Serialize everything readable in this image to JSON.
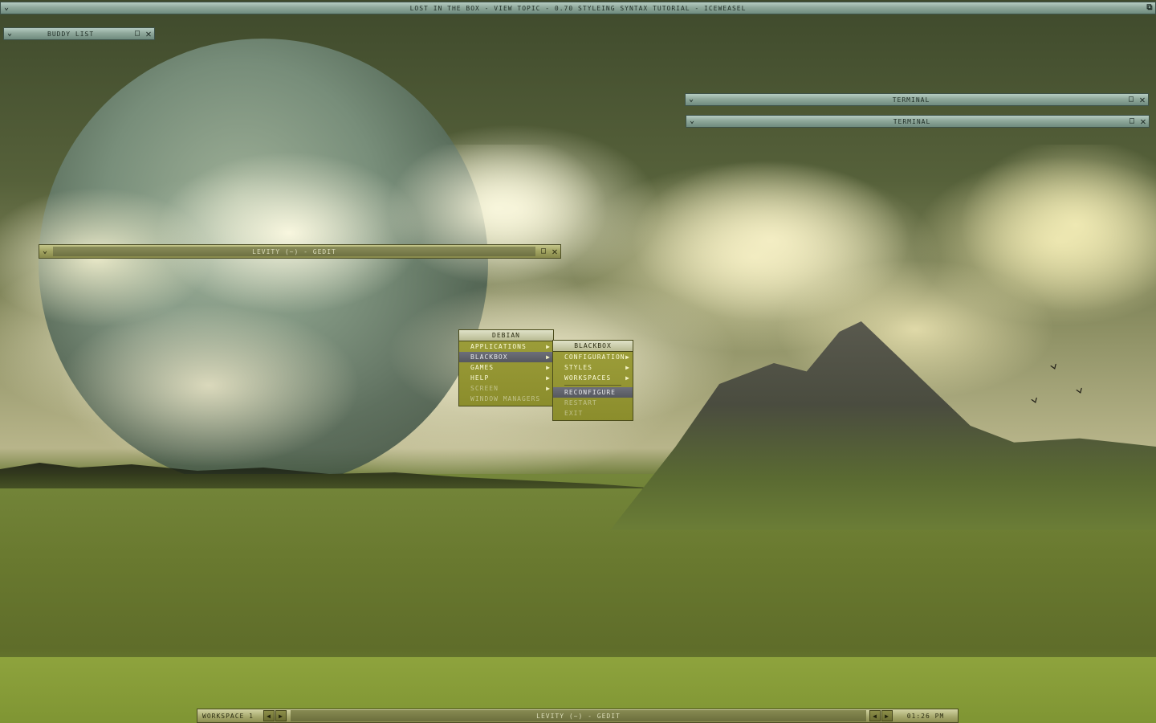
{
  "browser_window": {
    "title": "lost in the box - view topic - 0.70 styleing syntax tutorial - iceweasel"
  },
  "buddy_window": {
    "title": "buddy list"
  },
  "terminal_windows": [
    {
      "title": "terminal"
    },
    {
      "title": "terminal"
    }
  ],
  "gedit_window": {
    "title": "levity (~) - gedit"
  },
  "root_menu": {
    "title": "debian",
    "items": [
      {
        "label": "applications"
      },
      {
        "label": "blackbox"
      },
      {
        "label": "games"
      },
      {
        "label": "help"
      },
      {
        "label": "screen"
      },
      {
        "label": "window managers"
      }
    ]
  },
  "blackbox_menu": {
    "title": "blackbox",
    "items": [
      {
        "label": "configuration"
      },
      {
        "label": "styles"
      },
      {
        "label": "workspaces"
      },
      {
        "label": "reconfigure"
      },
      {
        "label": "restart"
      },
      {
        "label": "exit"
      }
    ]
  },
  "taskbar": {
    "workspace": "workspace 1",
    "task": "levity (~) - gedit",
    "clock": "01:26 pm"
  },
  "icons": {
    "minimize": "chevron-down-icon",
    "maximize": "maximize-icon",
    "close": "close-icon",
    "submenu": "triangle-right-icon"
  }
}
